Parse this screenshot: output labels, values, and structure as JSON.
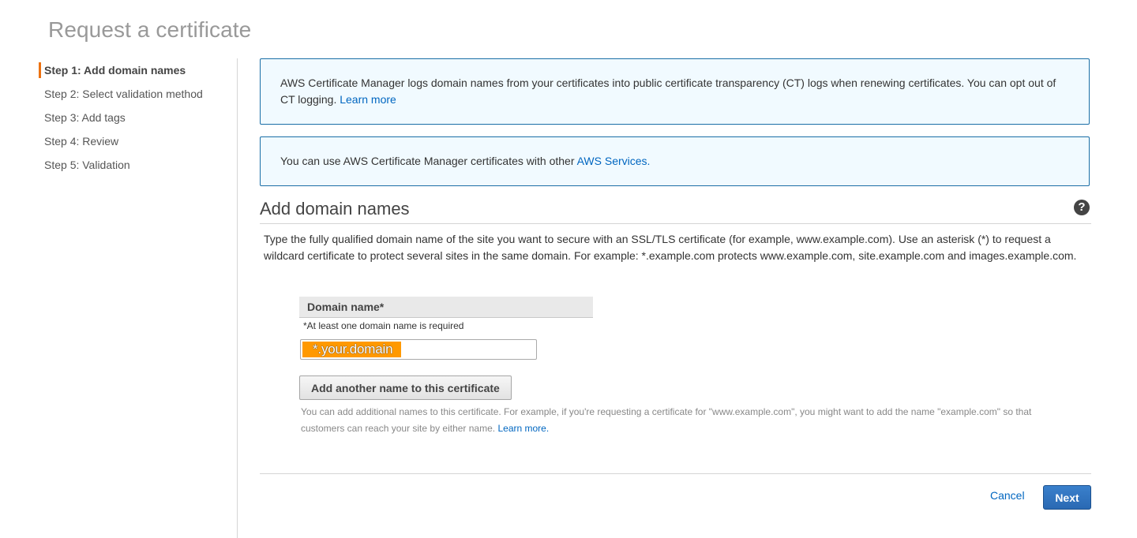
{
  "page": {
    "title": "Request a certificate"
  },
  "steps": [
    {
      "label": "Step 1: Add domain names",
      "active": true
    },
    {
      "label": "Step 2: Select validation method",
      "active": false
    },
    {
      "label": "Step 3: Add tags",
      "active": false
    },
    {
      "label": "Step 4: Review",
      "active": false
    },
    {
      "label": "Step 5: Validation",
      "active": false
    }
  ],
  "info_ct": {
    "text": "AWS Certificate Manager logs domain names from your certificates into public certificate transparency (CT) logs when renewing certificates. You can opt out of CT logging.",
    "link": "Learn more"
  },
  "info_services": {
    "text": "You can use AWS Certificate Manager certificates with other",
    "link": "AWS Services."
  },
  "section": {
    "title": "Add domain names",
    "help_icon": "question-circle-icon",
    "description": "Type the fully qualified domain name of the site you want to secure with an SSL/TLS certificate (for example, www.example.com). Use an asterisk (*) to request a wildcard certificate to protect several sites in the same domain. For example: *.example.com protects www.example.com, site.example.com and images.example.com."
  },
  "domain": {
    "header": "Domain name*",
    "required_note": "*At least one domain name is required",
    "value": "*.your.domain",
    "add_button": "Add another name to this certificate",
    "hint": "You can add additional names to this certificate. For example, if you're requesting a certificate for \"www.example.com\", you might want to add the name \"example.com\" so that customers can reach your site by either name.",
    "hint_link": "Learn more."
  },
  "footer": {
    "cancel": "Cancel",
    "next": "Next"
  },
  "colors": {
    "accent": "#ec7211",
    "link": "#0066c0",
    "info_border": "#1a6ea6",
    "info_bg": "#f1faff",
    "highlight": "#ff9900",
    "primary_button": "#2a69b3"
  }
}
